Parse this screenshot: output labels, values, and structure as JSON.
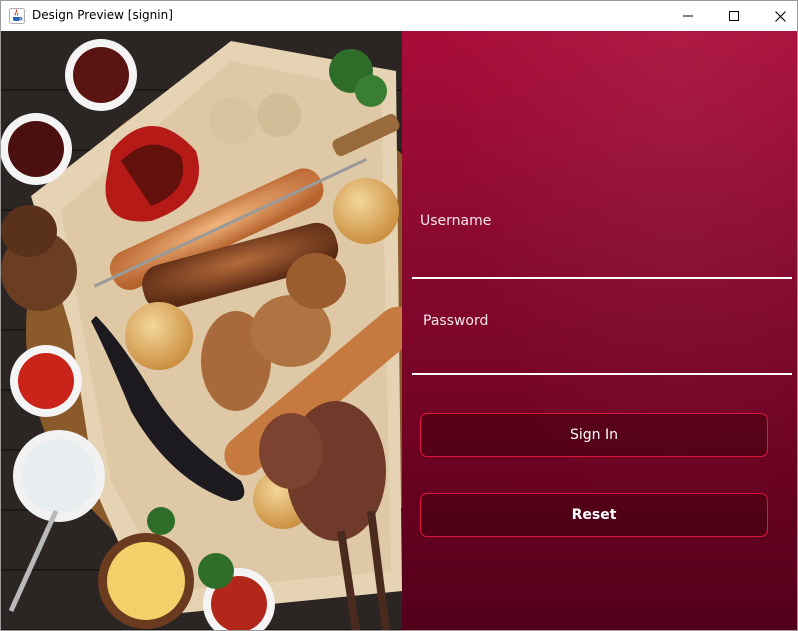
{
  "window": {
    "title": "Design Preview [signin]",
    "icon": "java-cup-icon",
    "controls": [
      "minimize",
      "maximize",
      "close"
    ]
  },
  "hero_image": {
    "description_icon": "grilled-food-platter-image"
  },
  "form": {
    "username_label": "Username",
    "username_value": "",
    "password_label": "Password",
    "password_value": "",
    "signin_label": "Sign In",
    "reset_label": "Reset"
  },
  "colors": {
    "panel_top": "#a90d3a",
    "panel_bottom": "#52001a",
    "button_border": "#e0153f",
    "underline": "#ffffff"
  }
}
